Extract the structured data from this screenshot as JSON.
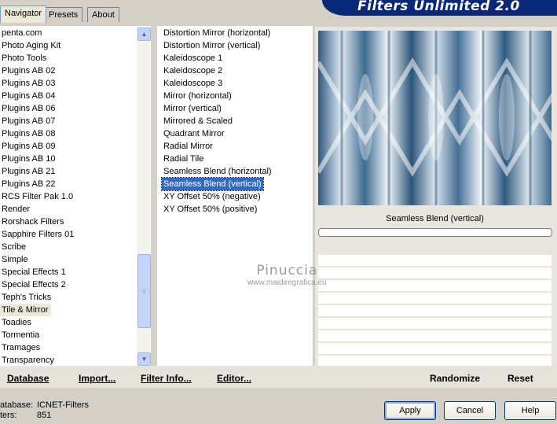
{
  "tabs": [
    "Navigator",
    "Presets",
    "About"
  ],
  "banner": {
    "title": "Filters Unlimited 2.0"
  },
  "categories": [
    "penta.com",
    "Photo Aging Kit",
    "Photo Tools",
    "Plugins AB 02",
    "Plugins AB 03",
    "Plugins AB 04",
    "Plugins AB 06",
    "Plugins AB 07",
    "Plugins AB 08",
    "Plugins AB 09",
    "Plugins AB 10",
    "Plugins AB 21",
    "Plugins AB 22",
    "RCS Filter Pak 1.0",
    "Render",
    "Rorshack Filters",
    "Sapphire Filters 01",
    "Scribe",
    "Simple",
    "Special Effects 1",
    "Special Effects 2",
    "Teph's Tricks",
    "Tile & Mirror",
    "Toadies",
    "Tormentia",
    "Tramages",
    "Transparency"
  ],
  "selected_category": "Tile & Mirror",
  "filters": [
    "Distortion Mirror (horizontal)",
    "Distortion Mirror (vertical)",
    "Kaleidoscope 1",
    "Kaleidoscope 2",
    "Kaleidoscope 3",
    "Mirror (horizontal)",
    "Mirror (vertical)",
    "Mirrored & Scaled",
    "Quadrant Mirror",
    "Radial Mirror",
    "Radial Tile",
    "Seamless Blend (horizontal)",
    "Seamless Blend (vertical)",
    "XY Offset 50% (negative)",
    "XY Offset 50% (positive)"
  ],
  "selected_filter": "Seamless Blend (vertical)",
  "preview": {
    "label": "Seamless Blend (vertical)"
  },
  "toolbar": {
    "database": "Database",
    "import": "Import...",
    "filter_info": "Filter Info...",
    "editor": "Editor...",
    "randomize": "Randomize",
    "reset": "Reset"
  },
  "status": {
    "database_label": "atabase:",
    "database_value": "ICNET-Filters",
    "filters_label": "ters:",
    "filters_value": "851"
  },
  "dialog": {
    "apply": "Apply",
    "cancel": "Cancel",
    "help": "Help"
  },
  "watermark": {
    "line1": "Pinuccia",
    "line2": "www.maidiregrafica.eu"
  },
  "scrollbar": {
    "up_icon": "arrow-up-icon",
    "down_icon": "arrow-down-icon"
  }
}
